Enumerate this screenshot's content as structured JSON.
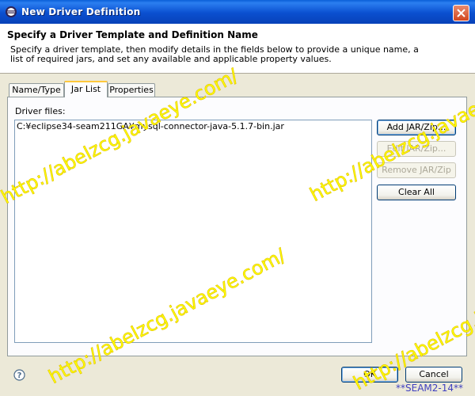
{
  "window": {
    "title": "New Driver Definition"
  },
  "header": {
    "title": "Specify a Driver Template and Definition Name",
    "description": "Specify a driver template, then modify details in the fields below to provide a unique name, a list of required jars, and set any available and applicable property values."
  },
  "tabs": [
    {
      "label": "Name/Type",
      "active": false
    },
    {
      "label": "Jar List",
      "active": true
    },
    {
      "label": "Properties",
      "active": false
    }
  ],
  "jar_list": {
    "label": "Driver files:",
    "files": [
      "C:¥eclipse34-seam211GA¥mysql-connector-java-5.1.7-bin.jar"
    ],
    "buttons": {
      "add": "Add JAR/Zip...",
      "edit": "Edit JAR/Zip...",
      "remove": "Remove JAR/Zip",
      "clear": "Clear All"
    }
  },
  "footer": {
    "ok": "OK",
    "cancel": "Cancel"
  },
  "watermark": {
    "text": "http://abelzcg.javaeye.com/",
    "tag": "**SEAM2-14**"
  },
  "colors": {
    "title_bar": "#0A4FD0",
    "active_tab_accent": "#FFC83C",
    "watermark": "#FFFF00"
  },
  "icons": {
    "title": "eclipse-icon",
    "close": "close-icon",
    "help": "help-icon"
  }
}
